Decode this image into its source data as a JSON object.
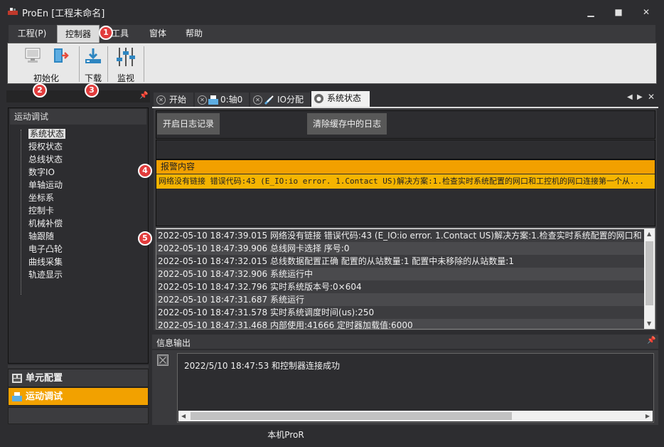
{
  "window": {
    "title": "ProEn [工程未命名]",
    "controls": [
      "minimize-icon",
      "maximize-icon",
      "close-icon"
    ]
  },
  "menu": {
    "items": [
      {
        "label": "工程(P)"
      },
      {
        "label": "控制器",
        "active": true
      },
      {
        "label": "工具"
      },
      {
        "label": "窗体"
      },
      {
        "label": "帮助"
      }
    ]
  },
  "ribbon": {
    "init_label": "初始化",
    "download_label": "下载",
    "monitor_label": "监视"
  },
  "badges": [
    "1",
    "2",
    "3",
    "4",
    "5"
  ],
  "left_panel": {
    "title": "运动调试",
    "items": [
      "系统状态",
      "授权状态",
      "总线状态",
      "数字IO",
      "单轴运动",
      "坐标系",
      "控制卡",
      "机械补偿",
      "轴跟随",
      "电子凸轮",
      "曲线采集",
      "轨迹显示"
    ],
    "selected_index": 0
  },
  "nav": {
    "unit_config": "单元配置",
    "motion_debug": "运动调试"
  },
  "tabs": [
    {
      "label": "开始"
    },
    {
      "label": "0:轴0"
    },
    {
      "label": "IO分配"
    },
    {
      "label": "系统状态",
      "active": true
    }
  ],
  "toolbar": {
    "start_log": "开启日志记录",
    "clear_log": "清除缓存中的日志"
  },
  "alarm": {
    "header": "报警内容",
    "message": "网络没有链接 错误代码:43 (E_IO:io error. 1.Contact US)解决方案:1.检查实时系统配置的网口和工控机的网口连接第一个从..."
  },
  "log": [
    "2022-05-10  18:47:39.015  网络没有链接 错误代码:43 (E_IO:io error. 1.Contact US)解决方案:1.检查实时系统配置的网口和",
    "2022-05-10  18:47:39.906  总线网卡选择 序号:0",
    "2022-05-10  18:47:32.015  总线数据配置正确 配置的从站数量:1 配置中未移除的从站数量:1",
    "2022-05-10  18:47:32.906  系统运行中",
    "2022-05-10  18:47:32.796  实时系统版本号:0×604",
    "2022-05-10  18:47:31.687  系统运行",
    "2022-05-10  18:47:31.578  实时系统调度时间(us):250",
    "2022-05-10  18:47:31.468  内部使用:41666 定时器加载值:6000"
  ],
  "info": {
    "title": "信息输出",
    "message": "2022/5/10  18:47:53 和控制器连接成功"
  },
  "status": {
    "text": "本机ProR"
  },
  "colors": {
    "accent": "#f2a100",
    "badge": "#e23c3c",
    "background": "#2d2d30"
  }
}
